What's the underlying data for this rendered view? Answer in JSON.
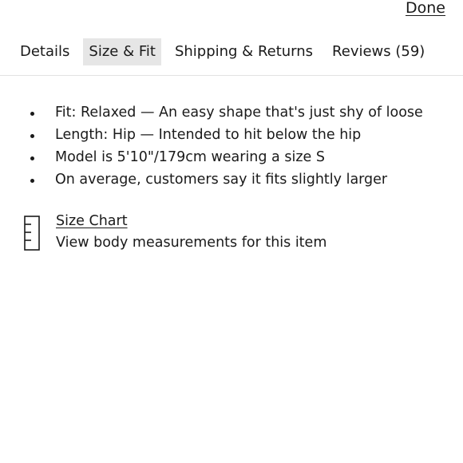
{
  "header": {
    "done_label": "Done"
  },
  "tabs": [
    {
      "label": "Details",
      "active": false
    },
    {
      "label": "Size & Fit",
      "active": true
    },
    {
      "label": "Shipping & Returns",
      "active": false
    },
    {
      "label": "Reviews (59)",
      "active": false
    }
  ],
  "fit_details": [
    "Fit: Relaxed — An easy shape that's just shy of loose",
    "Length: Hip — Intended to hit below the hip",
    "Model is 5'10\"/179cm wearing a size S",
    "On average, customers say it fits slightly larger"
  ],
  "size_chart": {
    "icon": "ruler-icon",
    "title": "Size Chart",
    "description": "View body measurements for this item"
  },
  "colors": {
    "text": "#1a1a1a",
    "active_tab_bg": "#e6e6e6",
    "divider": "#e2e2e2"
  }
}
